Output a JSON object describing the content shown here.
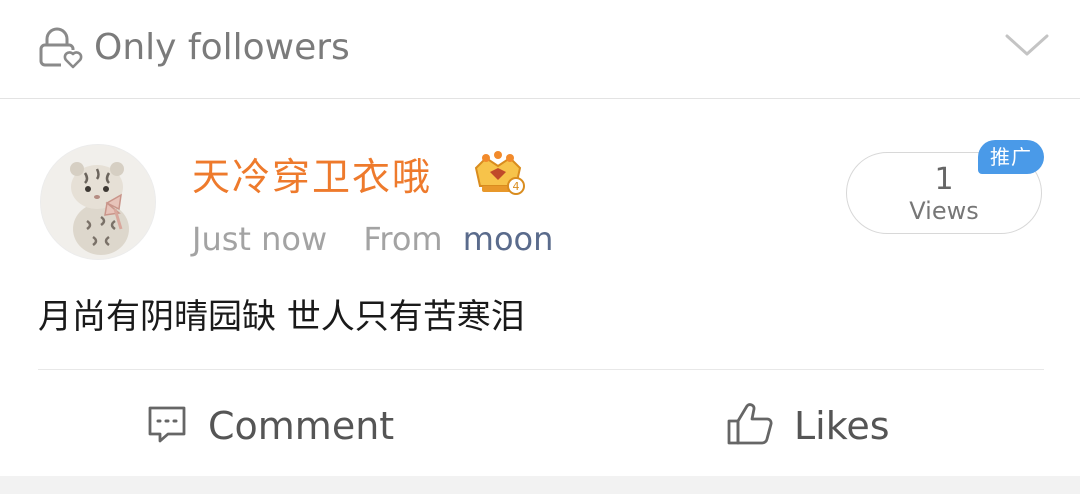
{
  "visibility": {
    "label": "Only followers",
    "icon": "lock-heart-icon",
    "dropdown_icon": "chevron-down-icon"
  },
  "post": {
    "username": "天冷穿卫衣哦",
    "username_color": "#ee7a2c",
    "badge_icon": "crown-badge-icon",
    "time": "Just now",
    "source_prefix": "From",
    "source": "moon",
    "views_count": "1",
    "views_label": "Views",
    "promo_badge": "推广",
    "content": "月尚有阴晴园缺 世人只有苦寒泪"
  },
  "actions": {
    "comment_label": "Comment",
    "like_label": "Likes"
  },
  "colors": {
    "accent_orange": "#ee7a2c",
    "badge_blue": "#4a9ae8",
    "link_blue": "#5a6b8c"
  }
}
